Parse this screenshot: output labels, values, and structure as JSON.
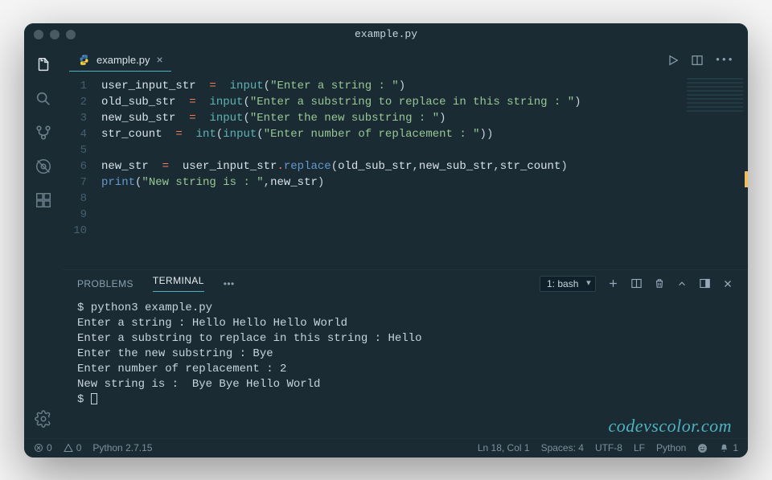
{
  "window": {
    "title": "example.py"
  },
  "tab": {
    "filename": "example.py"
  },
  "code": {
    "lines": [
      "user_input_str = input(\"Enter a string : \")",
      "old_sub_str = input(\"Enter a substring to replace in this string : \")",
      "new_sub_str = input(\"Enter the new substring : \")",
      "str_count = int(input(\"Enter number of replacement : \"))",
      "",
      "new_str = user_input_str.replace(old_sub_str,new_sub_str,str_count)",
      "print(\"New string is : \",new_str)",
      "",
      "",
      ""
    ]
  },
  "panel": {
    "tabs": {
      "problems": "PROBLEMS",
      "terminal": "TERMINAL"
    },
    "selector": "1: bash"
  },
  "terminal": {
    "lines": [
      "$ python3 example.py",
      "Enter a string : Hello Hello Hello World",
      "Enter a substring to replace in this string : Hello",
      "Enter the new substring : Bye",
      "Enter number of replacement : 2",
      "New string is :  Bye Bye Hello World",
      "$ "
    ]
  },
  "watermark": "codevscolor.com",
  "status": {
    "errors": "0",
    "warnings": "0",
    "python_version": "Python 2.7.15",
    "position": "Ln 18, Col 1",
    "spaces": "Spaces: 4",
    "encoding": "UTF-8",
    "eol": "LF",
    "lang": "Python",
    "bell": "1"
  }
}
